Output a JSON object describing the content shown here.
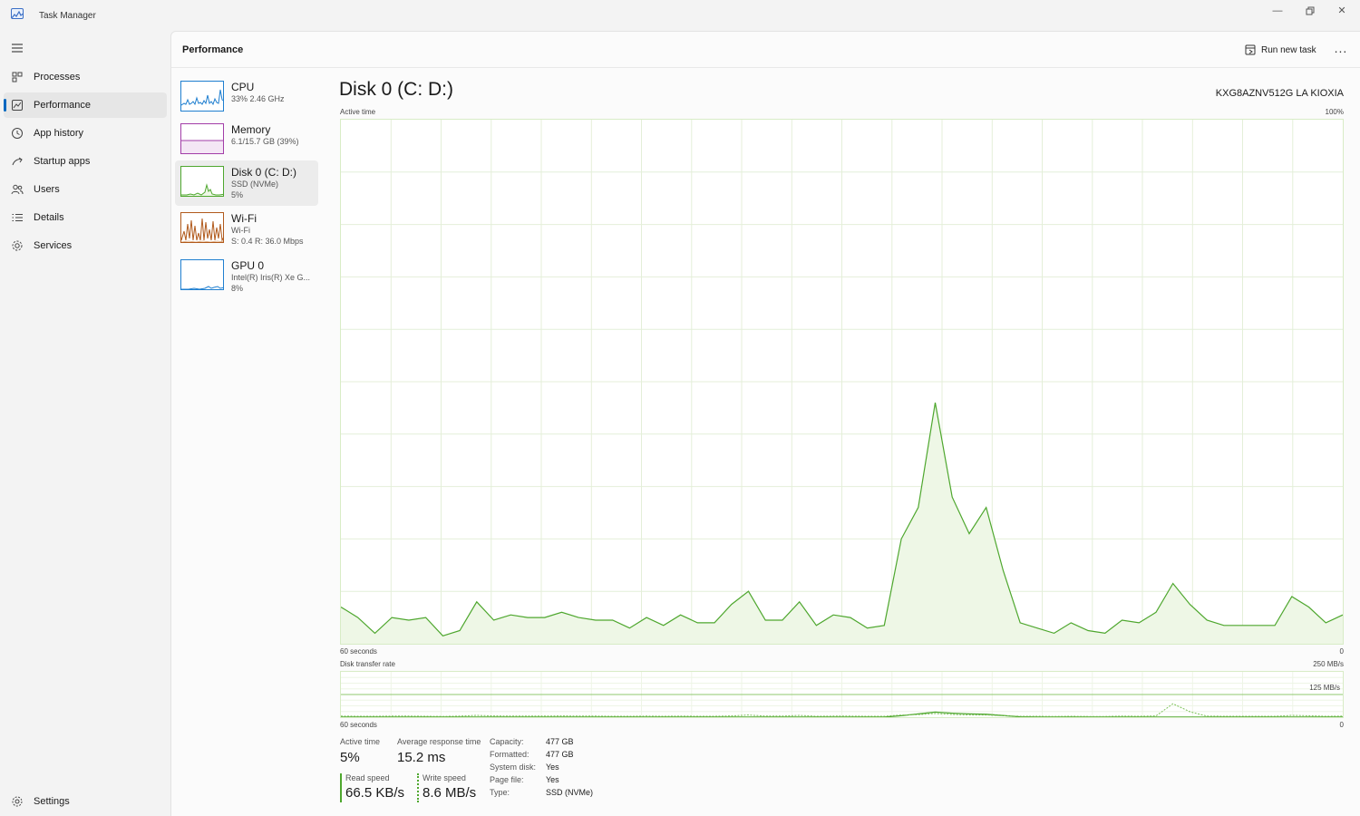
{
  "window": {
    "title": "Task Manager"
  },
  "nav": {
    "items": [
      {
        "label": "Processes",
        "icon": "processes-icon"
      },
      {
        "label": "Performance",
        "icon": "performance-icon",
        "active": true
      },
      {
        "label": "App history",
        "icon": "app-history-icon"
      },
      {
        "label": "Startup apps",
        "icon": "startup-apps-icon"
      },
      {
        "label": "Users",
        "icon": "users-icon"
      },
      {
        "label": "Details",
        "icon": "details-icon"
      },
      {
        "label": "Services",
        "icon": "services-icon"
      }
    ],
    "settings_label": "Settings"
  },
  "header": {
    "title": "Performance",
    "run_new_task_label": "Run new task",
    "more_label": "..."
  },
  "devices": [
    {
      "name": "CPU",
      "line1": "33% 2.46 GHz",
      "line2": "",
      "color": "#1f7fd0"
    },
    {
      "name": "Memory",
      "line1": "6.1/15.7 GB (39%)",
      "line2": "",
      "color": "#a23da8"
    },
    {
      "name": "Disk 0 (C: D:)",
      "line1": "SSD (NVMe)",
      "line2": "5%",
      "color": "#4ea72e",
      "selected": true
    },
    {
      "name": "Wi-Fi",
      "line1": "Wi-Fi",
      "line2": "S: 0.4 R: 36.0 Mbps",
      "color": "#b15a1c"
    },
    {
      "name": "GPU 0",
      "line1": "Intel(R) Iris(R) Xe G...",
      "line2": "8%",
      "color": "#1f7fd0"
    }
  ],
  "disk": {
    "title": "Disk 0 (C: D:)",
    "model": "KXG8AZNV512G LA KIOXIA",
    "active_time_label": "Active time",
    "active_max_label": "100%",
    "x_start_label": "60 seconds",
    "x_end_label": "0",
    "transfer_label": "Disk transfer rate",
    "transfer_max_label": "250 MB/s",
    "transfer_mid_label": "125 MB/s",
    "transfer_x_start_label": "60 seconds",
    "transfer_x_end_label": "0",
    "stats": {
      "active_time_label": "Active time",
      "active_time_value": "5%",
      "avg_response_label": "Average response time",
      "avg_response_value": "15.2 ms",
      "read_speed_label": "Read speed",
      "read_speed_value": "66.5 KB/s",
      "write_speed_label": "Write speed",
      "write_speed_value": "8.6 MB/s"
    },
    "properties": [
      {
        "key": "Capacity:",
        "value": "477 GB"
      },
      {
        "key": "Formatted:",
        "value": "477 GB"
      },
      {
        "key": "System disk:",
        "value": "Yes"
      },
      {
        "key": "Page file:",
        "value": "Yes"
      },
      {
        "key": "Type:",
        "value": "SSD (NVMe)"
      }
    ]
  },
  "colors": {
    "accent": "#0067c0",
    "disk_line": "#4ea72e",
    "disk_fill": "#eef7e6",
    "grid": "#e4efd9"
  },
  "chart_data": [
    {
      "type": "area",
      "title": "Active time",
      "xlabel": "",
      "ylabel": "",
      "x_range_labels": [
        "60 seconds",
        "0"
      ],
      "ylim": [
        0,
        100
      ],
      "series": [
        {
          "values": [
            7,
            5,
            2,
            5,
            4.5,
            5,
            1.5,
            2.5,
            8,
            4.5,
            5.5,
            5,
            5,
            6,
            5,
            4.5,
            4.5,
            3,
            5,
            3.5,
            5.5,
            4,
            4,
            7.5,
            10,
            4.5,
            4.5,
            8,
            3.5,
            5.5,
            5,
            3,
            3.5,
            20,
            26,
            46,
            28,
            21,
            26,
            14,
            4,
            3,
            2,
            4,
            2.5,
            2,
            4.5,
            4,
            6,
            11.5,
            7.5,
            4.5,
            3.5,
            3.5,
            3.5,
            3.5,
            9,
            7,
            4,
            5.5
          ]
        }
      ]
    },
    {
      "type": "line",
      "title": "Disk transfer rate",
      "xlabel": "",
      "ylabel": "",
      "x_range_labels": [
        "60 seconds",
        "0"
      ],
      "ylim": [
        0,
        250
      ],
      "reference_line": 125,
      "series": [
        {
          "name": "Read speed",
          "values": [
            0.3,
            0.3,
            0.3,
            0.3,
            0.3,
            0.3,
            0.3,
            0.3,
            0.3,
            0.3,
            0.3,
            0.3,
            0.3,
            0.3,
            0.3,
            0.3,
            0.3,
            0.3,
            0.3,
            0.3,
            0.3,
            0.3,
            0.3,
            0.3,
            0.3,
            0.3,
            0.3,
            0.3,
            0.3,
            0.3,
            0.3,
            0.3,
            0.3,
            8,
            18,
            28,
            22,
            18,
            16,
            9,
            2,
            0.3,
            0.3,
            0.3,
            0.3,
            0.3,
            0.3,
            0.3,
            0.3,
            0.3,
            0.3,
            0.3,
            0.3,
            0.3,
            0.3,
            0.3,
            0.3,
            0.3,
            0.3,
            0.3
          ]
        },
        {
          "name": "Write speed",
          "values": [
            6,
            5,
            5,
            6,
            6,
            5,
            4,
            6,
            10,
            7,
            6,
            6,
            6,
            7,
            6,
            6,
            5,
            5,
            6,
            5,
            6,
            5,
            5,
            7,
            12,
            6,
            6,
            10,
            5,
            6,
            6,
            5,
            5,
            12,
            14,
            20,
            15,
            12,
            12,
            8,
            5,
            5,
            4,
            5,
            4,
            4,
            6,
            5,
            7,
            74,
            30,
            6,
            5,
            5,
            5,
            5,
            10,
            8,
            5,
            6
          ]
        }
      ]
    }
  ]
}
